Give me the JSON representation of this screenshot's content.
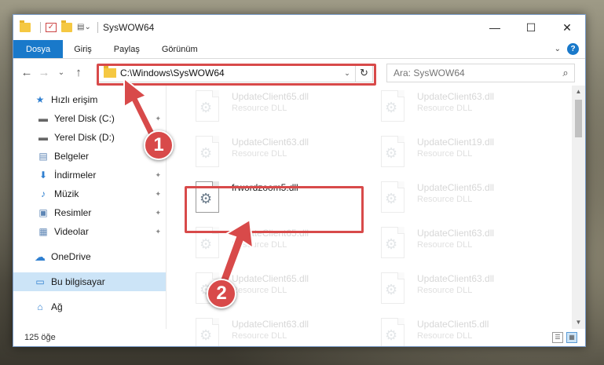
{
  "window": {
    "title": "SysWOW64",
    "controls": {
      "minimize": "—",
      "maximize": "☐",
      "close": "✕"
    }
  },
  "ribbon": {
    "tabs": [
      "Dosya",
      "Giriş",
      "Paylaş",
      "Görünüm"
    ],
    "expand_glyph": "⌄",
    "help_glyph": "?"
  },
  "nav": {
    "back": "←",
    "forward": "→",
    "recent": "⌄",
    "up": "↑"
  },
  "address": {
    "path": "C:\\Windows\\SysWOW64",
    "dropdown": "⌄",
    "refresh": "↻"
  },
  "search": {
    "placeholder": "Ara: SysWOW64",
    "icon": "⌕"
  },
  "sidebar": {
    "items": [
      {
        "label": "Hızlı erişim",
        "icon": "star-icon",
        "glyph": "★",
        "pinned": false
      },
      {
        "label": "Yerel Disk (C:)",
        "icon": "drive-icon",
        "glyph": "▬",
        "pinned": true
      },
      {
        "label": "Yerel Disk (D:)",
        "icon": "drive-icon",
        "glyph": "▬",
        "pinned": true
      },
      {
        "label": "Belgeler",
        "icon": "document-icon",
        "glyph": "▤",
        "pinned": true
      },
      {
        "label": "İndirmeler",
        "icon": "download-icon",
        "glyph": "⬇",
        "pinned": true
      },
      {
        "label": "Müzik",
        "icon": "music-icon",
        "glyph": "♪",
        "pinned": true
      },
      {
        "label": "Resimler",
        "icon": "picture-icon",
        "glyph": "▣",
        "pinned": true
      },
      {
        "label": "Videolar",
        "icon": "video-icon",
        "glyph": "▦",
        "pinned": true
      },
      {
        "label": "OneDrive",
        "icon": "cloud-icon",
        "glyph": "☁",
        "pinned": false
      },
      {
        "label": "Bu bilgisayar",
        "icon": "computer-icon",
        "glyph": "▭",
        "pinned": false
      },
      {
        "label": "Ağ",
        "icon": "network-icon",
        "glyph": "⌂",
        "pinned": false
      }
    ],
    "pin_glyph": "📌"
  },
  "files": {
    "items": [
      {
        "name": "UpdateClient65.dll",
        "desc": "Resource DLL",
        "faded": true
      },
      {
        "name": "UpdateClient63.dll",
        "desc": "Resource DLL",
        "faded": true
      },
      {
        "name": "UpdateClient63.dll",
        "desc": "Resource DLL",
        "faded": true
      },
      {
        "name": "UpdateClient19.dll",
        "desc": "Resource DLL",
        "faded": true
      },
      {
        "name": "frwordzoom5.dll",
        "desc": "",
        "faded": false
      },
      {
        "name": "UpdateClient65.dll",
        "desc": "Resource DLL",
        "faded": true
      },
      {
        "name": "UpdateClient65.dll",
        "desc": "Resource DLL",
        "faded": true
      },
      {
        "name": "UpdateClient63.dll",
        "desc": "Resource DLL",
        "faded": true
      },
      {
        "name": "UpdateClient65.dll",
        "desc": "Resource DLL",
        "faded": true
      },
      {
        "name": "UpdateClient63.dll",
        "desc": "Resource DLL",
        "faded": true
      },
      {
        "name": "UpdateClient63.dll",
        "desc": "Resource DLL",
        "faded": true
      },
      {
        "name": "UpdateClient5.dll",
        "desc": "Resource DLL",
        "faded": true
      }
    ]
  },
  "status": {
    "count": "125 öğe"
  },
  "callouts": [
    "1",
    "2"
  ],
  "colors": {
    "accent": "#1979ca",
    "highlight": "#d84a4a",
    "selected": "#cce4f7"
  }
}
